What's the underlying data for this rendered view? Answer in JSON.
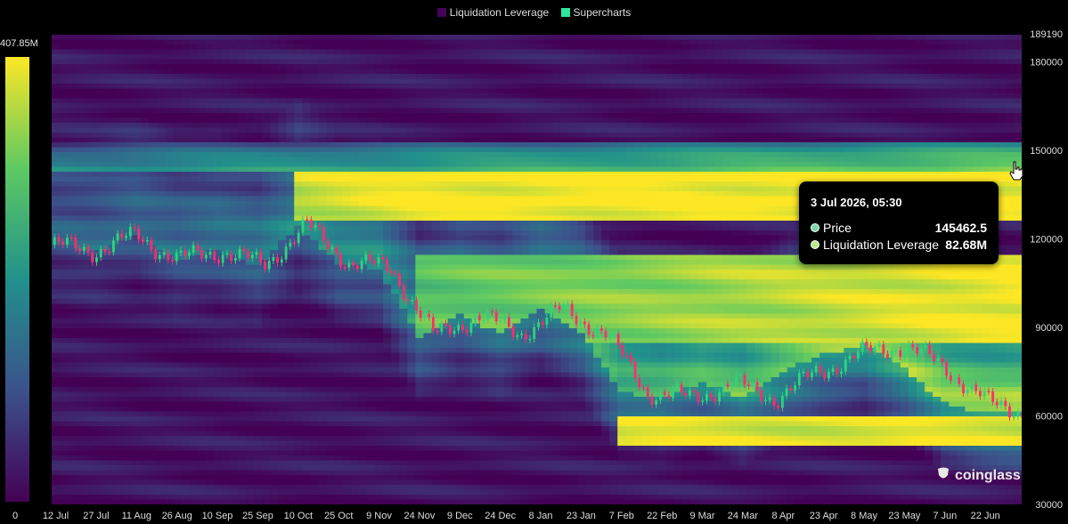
{
  "legend": [
    {
      "label": "Liquidation Leverage",
      "color": "#44015a"
    },
    {
      "label": "Supercharts",
      "color": "#2ee59d"
    }
  ],
  "colorbar": {
    "max_label": "407.85M",
    "min_label": "0",
    "max": 407.85,
    "min": 0,
    "unit": "M"
  },
  "tooltip": {
    "title": "3 Jul 2026, 05:30",
    "rows": [
      {
        "label": "Price",
        "value": "145462.5",
        "dot_color": "#7fd6a6"
      },
      {
        "label": "Liquidation Leverage",
        "value": "82.68M",
        "dot_color": "#b7e88a"
      }
    ]
  },
  "watermark": "coinglass",
  "chart_data": {
    "type": "heatmap",
    "title": "",
    "x_ticks": [
      "12 Jul",
      "27 Jul",
      "11 Aug",
      "26 Aug",
      "10 Sep",
      "25 Sep",
      "10 Oct",
      "25 Oct",
      "9 Nov",
      "24 Nov",
      "9 Dec",
      "24 Dec",
      "8 Jan",
      "23 Jan",
      "7 Feb",
      "22 Feb",
      "9 Mar",
      "24 Mar",
      "8 Apr",
      "23 Apr",
      "8 May",
      "23 May",
      "7 Jun",
      "22 Jun"
    ],
    "y_ticks": [
      180000,
      150000,
      120000,
      90000,
      60000,
      30000
    ],
    "y_top_label": "189190",
    "ylim": [
      30000,
      189190
    ],
    "colormap": [
      "#440154",
      "#3b528b",
      "#21918c",
      "#5ec962",
      "#fde725"
    ],
    "price_series": {
      "name": "Price",
      "x_index": [
        0,
        1,
        2,
        3,
        4,
        5,
        6,
        7,
        8,
        9,
        10,
        11,
        12,
        13,
        14,
        15,
        16,
        17,
        18,
        19,
        20,
        21,
        22,
        23
      ],
      "close": [
        118000,
        116000,
        121000,
        113000,
        116000,
        111000,
        124500,
        112000,
        110000,
        87000,
        94000,
        88000,
        96000,
        88000,
        68000,
        66000,
        71000,
        66000,
        75000,
        81000,
        84000,
        76000,
        64000,
        61000
      ]
    },
    "high_band": {
      "from": 126000,
      "to": 143000,
      "start_index": 6,
      "note_level": "max"
    },
    "low_band": {
      "from": 50000,
      "to": 60000,
      "start_index": 14,
      "note_level": "max"
    }
  }
}
